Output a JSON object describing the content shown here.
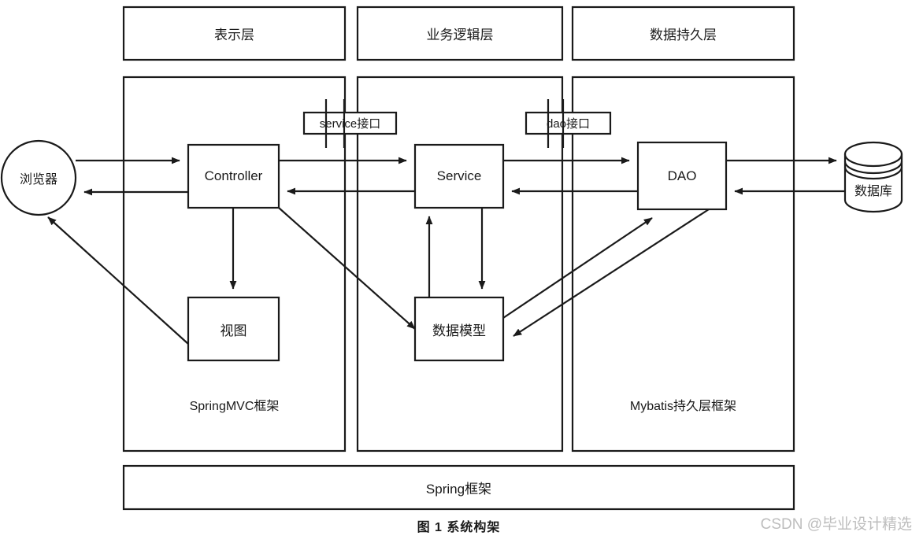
{
  "figure": {
    "caption": "图 1   系统构架",
    "watermark": "CSDN @毕业设计精选"
  },
  "layers": {
    "headers": [
      {
        "label": "表示层"
      },
      {
        "label": "业务逻辑层"
      },
      {
        "label": "数据持久层"
      }
    ],
    "frameworks": [
      {
        "label": "SpringMVC框架"
      },
      {
        "label": ""
      },
      {
        "label": "Mybatis持久层框架"
      }
    ],
    "foundation": {
      "label": "Spring框架"
    }
  },
  "nodes": {
    "browser": {
      "label": "浏览器",
      "shape": "circle"
    },
    "controller": {
      "label": "Controller",
      "shape": "rect"
    },
    "view": {
      "label": "视图",
      "shape": "rect"
    },
    "service": {
      "label": "Service",
      "shape": "rect"
    },
    "model": {
      "label": "数据模型",
      "shape": "rect"
    },
    "dao": {
      "label": "DAO",
      "shape": "rect"
    },
    "database": {
      "label": "数据库",
      "shape": "cylinder"
    }
  },
  "interfaces": [
    {
      "label": "service接口"
    },
    {
      "label": "dao接口"
    }
  ],
  "colors": {
    "stroke": "#1a1a1a",
    "background": "#ffffff",
    "watermark": "#bdbdbd"
  },
  "chart_data": {
    "type": "diagram",
    "title": "图 1   系统构架",
    "nodes": [
      {
        "id": "browser",
        "label": "浏览器",
        "shape": "circle",
        "layer": "表示层"
      },
      {
        "id": "controller",
        "label": "Controller",
        "shape": "rect",
        "layer": "表示层"
      },
      {
        "id": "view",
        "label": "视图",
        "shape": "rect",
        "layer": "表示层"
      },
      {
        "id": "service",
        "label": "Service",
        "shape": "rect",
        "layer": "业务逻辑层"
      },
      {
        "id": "model",
        "label": "数据模型",
        "shape": "rect",
        "layer": "业务逻辑层"
      },
      {
        "id": "dao",
        "label": "DAO",
        "shape": "rect",
        "layer": "数据持久层"
      },
      {
        "id": "database",
        "label": "数据库",
        "shape": "cylinder",
        "layer": "数据持久层"
      }
    ],
    "edges": [
      {
        "from": "browser",
        "to": "controller",
        "direction": "forward"
      },
      {
        "from": "controller",
        "to": "browser",
        "direction": "forward"
      },
      {
        "from": "controller",
        "to": "service",
        "direction": "forward",
        "label": "service接口"
      },
      {
        "from": "service",
        "to": "controller",
        "direction": "forward",
        "label": "service接口"
      },
      {
        "from": "service",
        "to": "dao",
        "direction": "forward",
        "label": "dao接口"
      },
      {
        "from": "dao",
        "to": "service",
        "direction": "forward",
        "label": "dao接口"
      },
      {
        "from": "dao",
        "to": "database",
        "direction": "forward"
      },
      {
        "from": "database",
        "to": "dao",
        "direction": "forward"
      },
      {
        "from": "controller",
        "to": "view",
        "direction": "forward"
      },
      {
        "from": "view",
        "to": "browser",
        "direction": "forward"
      },
      {
        "from": "controller",
        "to": "model",
        "direction": "forward"
      },
      {
        "from": "service",
        "to": "model",
        "direction": "forward"
      },
      {
        "from": "model",
        "to": "service",
        "direction": "forward"
      },
      {
        "from": "model",
        "to": "dao",
        "direction": "forward"
      },
      {
        "from": "dao",
        "to": "model",
        "direction": "forward"
      }
    ]
  }
}
